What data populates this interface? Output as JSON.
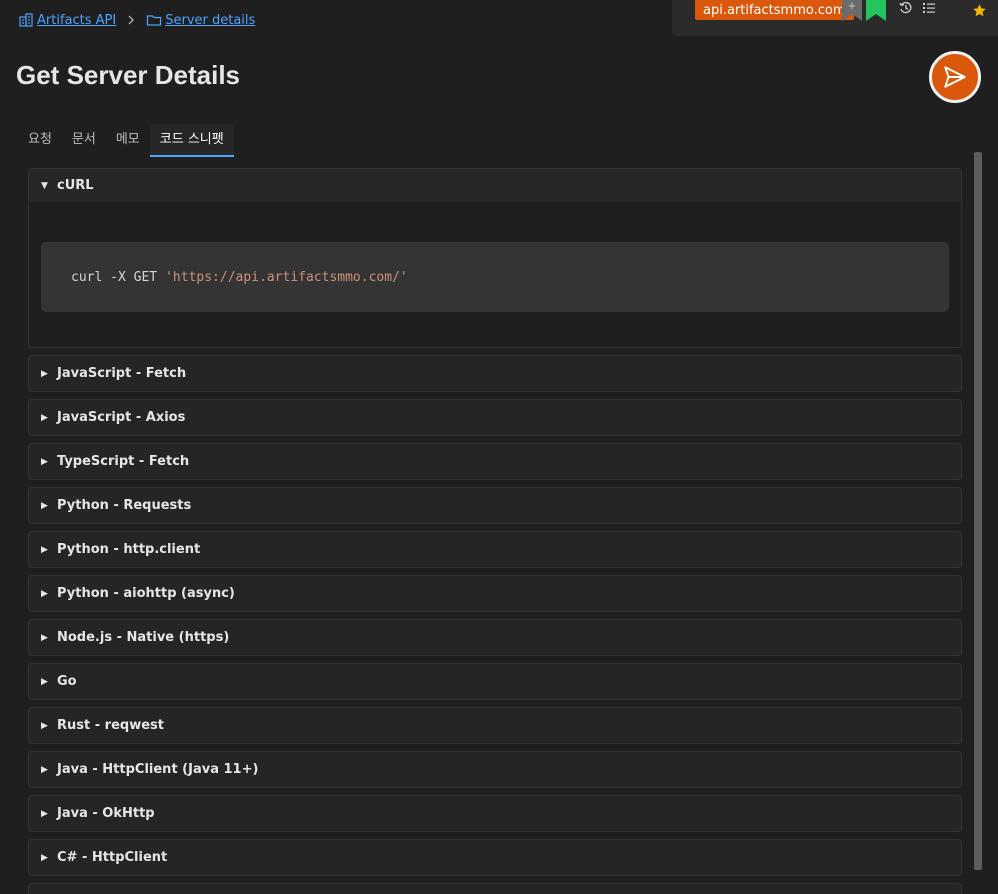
{
  "breadcrumb": {
    "root": "Artifacts API",
    "current": "Server details"
  },
  "topbar": {
    "url": "api.artifactsmmo.com"
  },
  "page": {
    "title": "Get Server Details"
  },
  "tabs": [
    {
      "label": "요청",
      "active": false
    },
    {
      "label": "문서",
      "active": false
    },
    {
      "label": "메모",
      "active": false
    },
    {
      "label": "코드 스니펫",
      "active": true
    }
  ],
  "snippets": {
    "open": {
      "label": "cURL",
      "code_cmd": "curl -X GET",
      "code_url": "'https://api.artifactsmmo.com/'"
    },
    "items": [
      "JavaScript - Fetch",
      "JavaScript - Axios",
      "TypeScript - Fetch",
      "Python - Requests",
      "Python - http.client",
      "Python - aiohttp (async)",
      "Node.js - Native (https)",
      "Go",
      "Rust - reqwest",
      "Java - HttpClient (Java 11+)",
      "Java - OkHttp",
      "C# - HttpClient"
    ]
  },
  "colors": {
    "accent": "#d9580b",
    "link": "#4da3ff",
    "bookmark_green": "#22c55e",
    "star": "#f5b800"
  }
}
